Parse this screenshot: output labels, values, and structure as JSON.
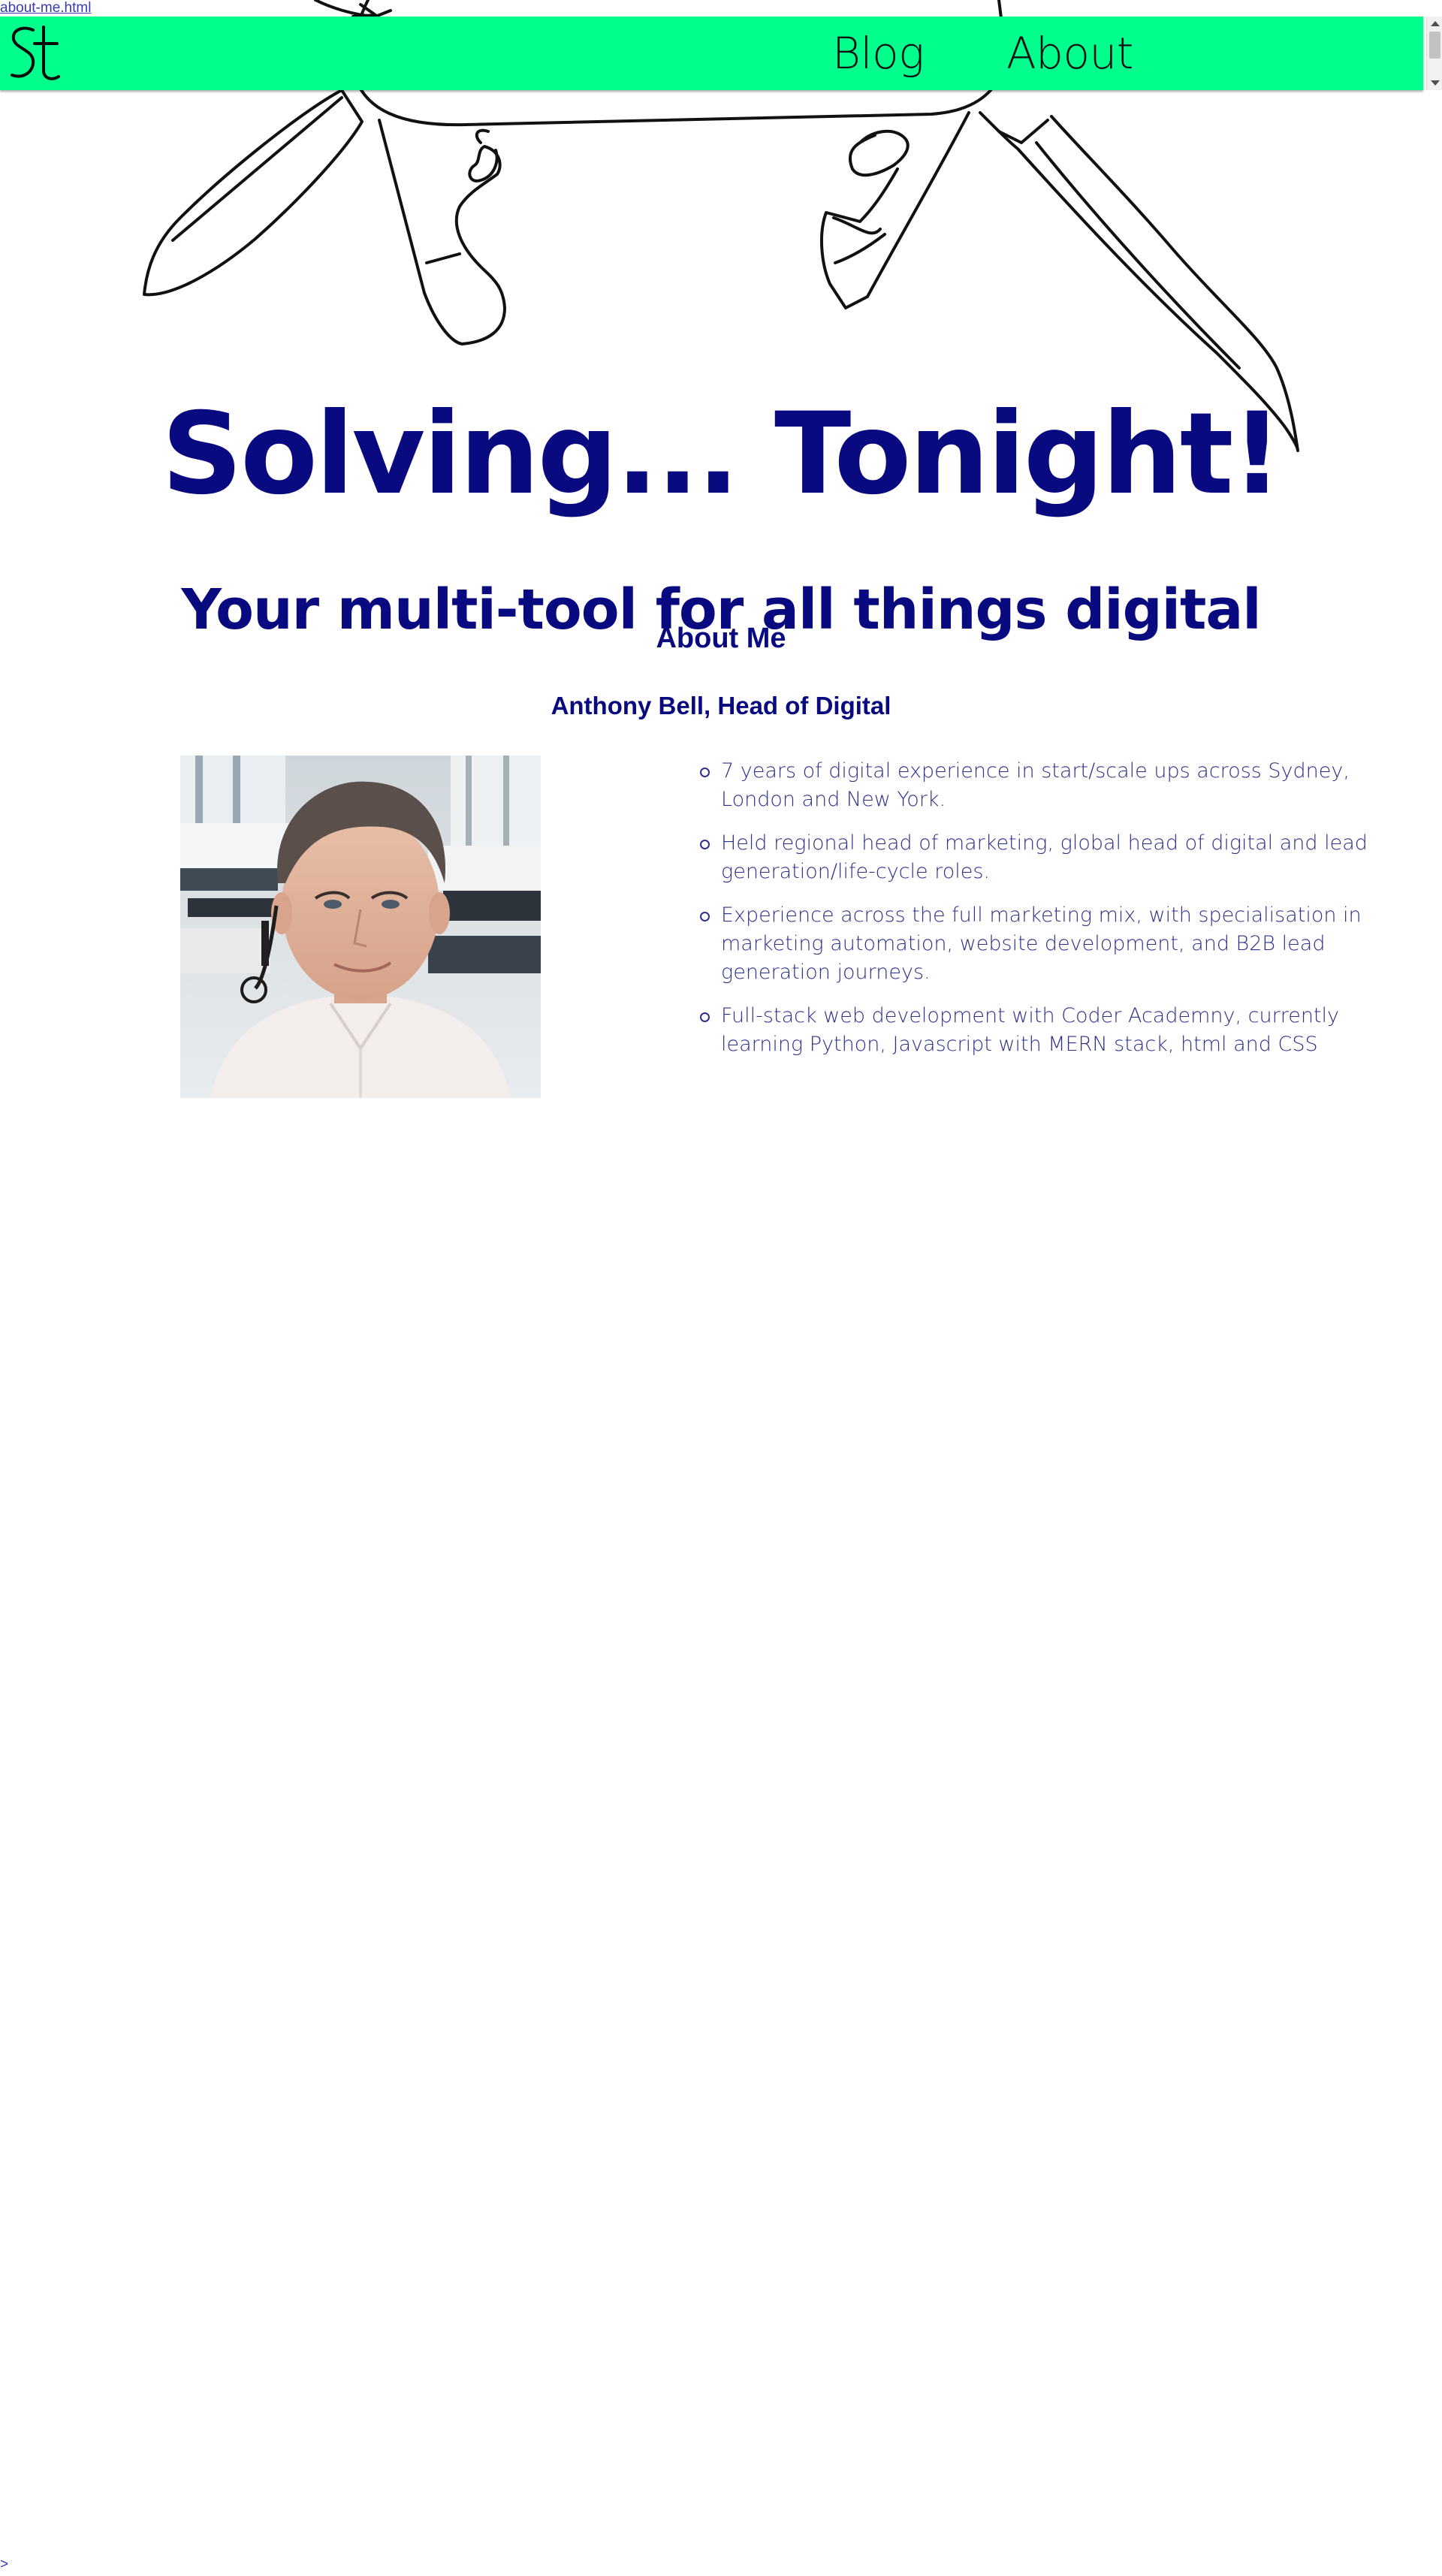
{
  "file_link": "about-me.html",
  "nav": {
    "logo_icon": "st-monogram-logo",
    "links": [
      "Blog",
      "About"
    ],
    "accent_color": "#00ff8c"
  },
  "hero": {
    "illustration": "swiss-army-knife-icon",
    "title": "Solving... Tonight!",
    "subtitle": "Your multi-tool for all things digital"
  },
  "about": {
    "heading": "About Me",
    "name": "Anthony Bell, Head of Digital",
    "photo": "portrait-photo",
    "bullets": [
      "7 years of digital experience in start/scale ups across Sydney, London and New York.",
      "Held regional head of marketing, global head of digital and lead generation/life-cycle roles.",
      "Experience across the full marketing mix, with specialisation in marketing automation, website development, and B2B lead generation journeys.",
      "Full-stack web development with Coder Academny, currently learning Python, Javascript with MERN stack, html and CSS"
    ]
  },
  "stray_text": ">",
  "colors": {
    "heading": "#0a0a80",
    "body_text": "#2f2f8c",
    "nav_background": "#00ff8c"
  }
}
